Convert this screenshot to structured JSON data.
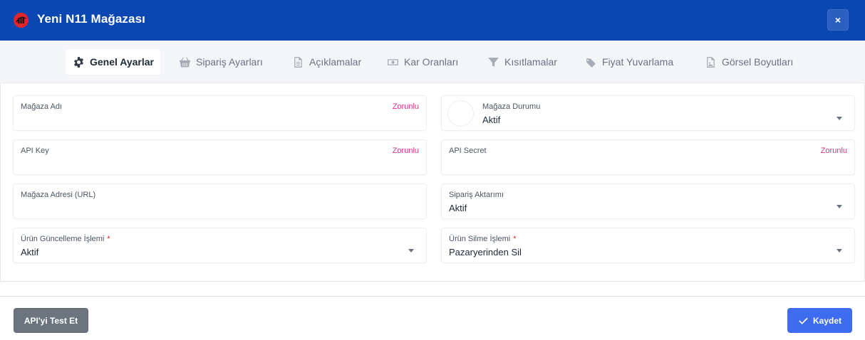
{
  "header": {
    "title": "Yeni N11 Mağazası",
    "close_label": "×",
    "brand_color": "#0b47b3"
  },
  "tabs": [
    {
      "label": "Genel Ayarlar",
      "icon": "gear-icon",
      "active": true
    },
    {
      "label": "Sipariş Ayarları",
      "icon": "basket-icon",
      "active": false
    },
    {
      "label": "Açıklamalar",
      "icon": "document-icon",
      "active": false
    },
    {
      "label": "Kar Oranları",
      "icon": "money-icon",
      "active": false
    },
    {
      "label": "Kısıtlamalar",
      "icon": "filter-icon",
      "active": false
    },
    {
      "label": "Fiyat Yuvarlama",
      "icon": "tags-icon",
      "active": false
    },
    {
      "label": "Görsel Boyutları",
      "icon": "image-file-icon",
      "active": false
    }
  ],
  "fields": {
    "store_name": {
      "label": "Mağaza Adı",
      "hint": "Zorunlu",
      "value": ""
    },
    "store_status": {
      "label": "Mağaza Durumu",
      "value": "Aktif"
    },
    "api_key": {
      "label": "API Key",
      "hint": "Zorunlu",
      "value": ""
    },
    "api_secret": {
      "label": "API Secret",
      "hint": "Zorunlu",
      "value": ""
    },
    "store_url": {
      "label": "Mağaza Adresi (URL)",
      "value": ""
    },
    "order_transfer": {
      "label": "Sipariş Aktarımı",
      "value": "Aktif"
    },
    "product_update": {
      "label": "Ürün Güncelleme İşlemi",
      "required_mark": "*",
      "value": "Aktif"
    },
    "product_delete": {
      "label": "Ürün Silme İşlemi",
      "required_mark": "*",
      "value": "Pazaryerinden Sil"
    }
  },
  "footer": {
    "test_label": "API'yi Test Et",
    "save_label": "Kaydet",
    "save_color": "#3d6cf0",
    "test_color": "#6c757d"
  }
}
